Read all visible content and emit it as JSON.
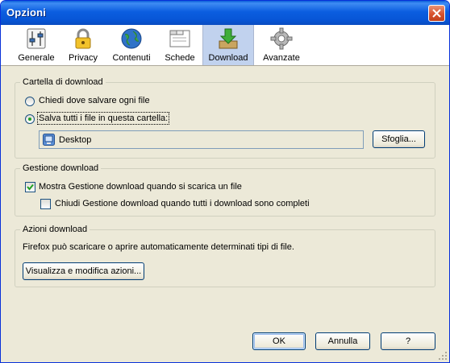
{
  "window": {
    "title": "Opzioni"
  },
  "toolbar": {
    "items": [
      {
        "label": "Generale",
        "icon": "sliders-icon"
      },
      {
        "label": "Privacy",
        "icon": "padlock-icon"
      },
      {
        "label": "Contenuti",
        "icon": "globe-icon"
      },
      {
        "label": "Schede",
        "icon": "tabs-window-icon"
      },
      {
        "label": "Download",
        "icon": "download-arrow-icon",
        "active": true
      },
      {
        "label": "Avanzate",
        "icon": "gear-icon"
      }
    ]
  },
  "download_folder": {
    "legend": "Cartella di download",
    "ask_label": "Chiedi dove salvare ogni file",
    "save_label": "Salva tutti i file in questa cartella:",
    "selected": "save",
    "folder_name": "Desktop",
    "browse_label": "Sfoglia..."
  },
  "download_manager": {
    "legend": "Gestione download",
    "show_label": "Mostra Gestione download quando si scarica un file",
    "show_checked": true,
    "close_label": "Chiudi Gestione download quando tutti i download sono completi",
    "close_checked": false
  },
  "download_actions": {
    "legend": "Azioni download",
    "description": "Firefox può scaricare o aprire automaticamente determinati tipi di file.",
    "button_label": "Visualizza e modifica azioni..."
  },
  "footer": {
    "ok_label": "OK",
    "cancel_label": "Annulla",
    "help_label": "?"
  },
  "colors": {
    "titlebar": "#0755d6",
    "window_bg": "#ece9d8",
    "active_tab": "#c1d2ee"
  }
}
